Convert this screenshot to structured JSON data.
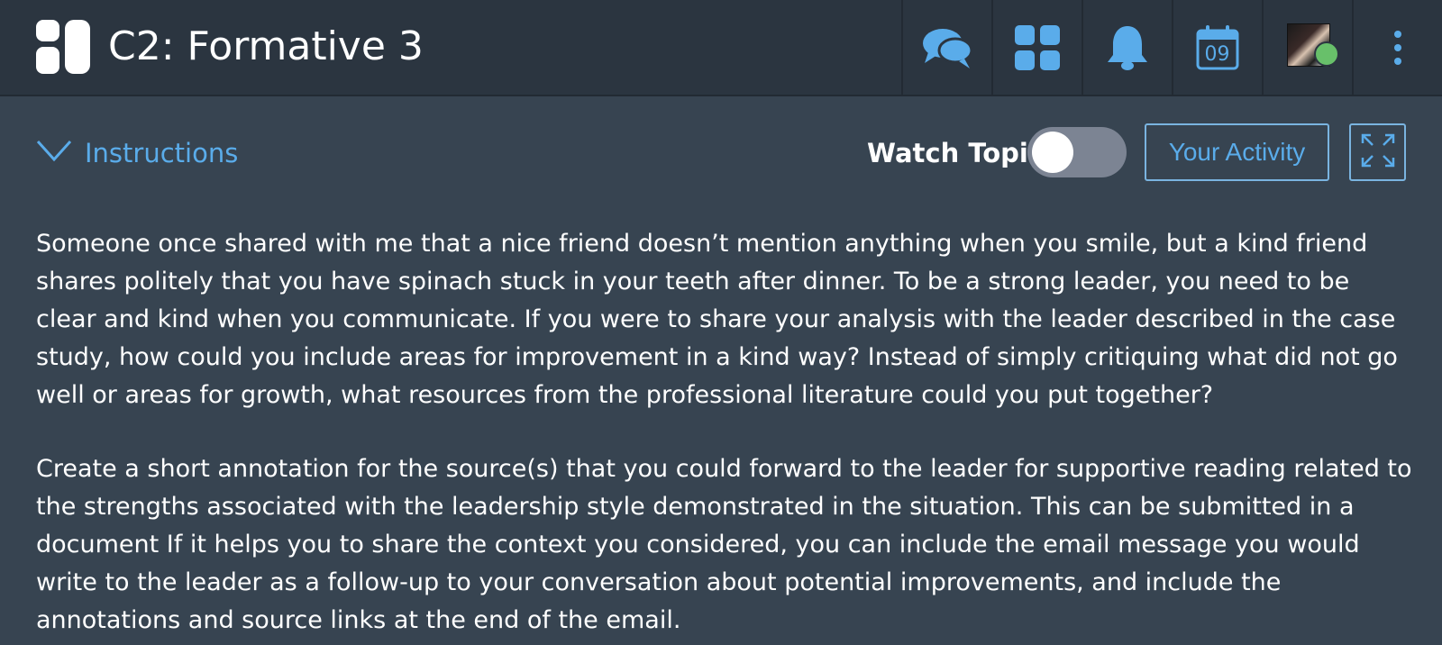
{
  "header": {
    "title": "C2: Formative 3",
    "calendar_day": "09"
  },
  "icons": {
    "logo": "app-logo-icon",
    "chat": "chat-bubbles-icon",
    "apps": "grid-apps-icon",
    "notifications": "bell-icon",
    "calendar": "calendar-icon",
    "more": "vertical-dots-icon",
    "instructions": "chevron-down-icon",
    "expand": "expand-icon"
  },
  "colors": {
    "accent": "#5aacea",
    "header_bg": "#2b3540",
    "page_bg": "#374451",
    "status_online": "#68c06a"
  },
  "controls": {
    "instructions_label": "Instructions",
    "watch_topic_label": "Watch Topic",
    "watch_topic_on": false,
    "your_activity_label": "Your Activity"
  },
  "instructions": {
    "paragraphs": [
      "Someone once shared with me that a nice friend doesn’t mention anything when you smile, but a kind friend shares politely that you have spinach stuck in your teeth after dinner. To be a strong leader, you need to be clear and kind when you communicate. If you were to share your analysis with the leader described in the case study, how could you include areas for improvement in a kind way? Instead of simply critiquing what did not go well or areas for growth, what resources from the professional literature could you put together?",
      "Create a short annotation for the source(s) that you could forward to the leader for supportive reading related to the strengths associated with the leadership style demonstrated in the situation. This can be submitted in a document If it helps you to share the context you considered, you can include the email message you would write to the leader as a follow-up to your conversation about potential improvements, and include the annotations and source links at the end of the email."
    ]
  }
}
